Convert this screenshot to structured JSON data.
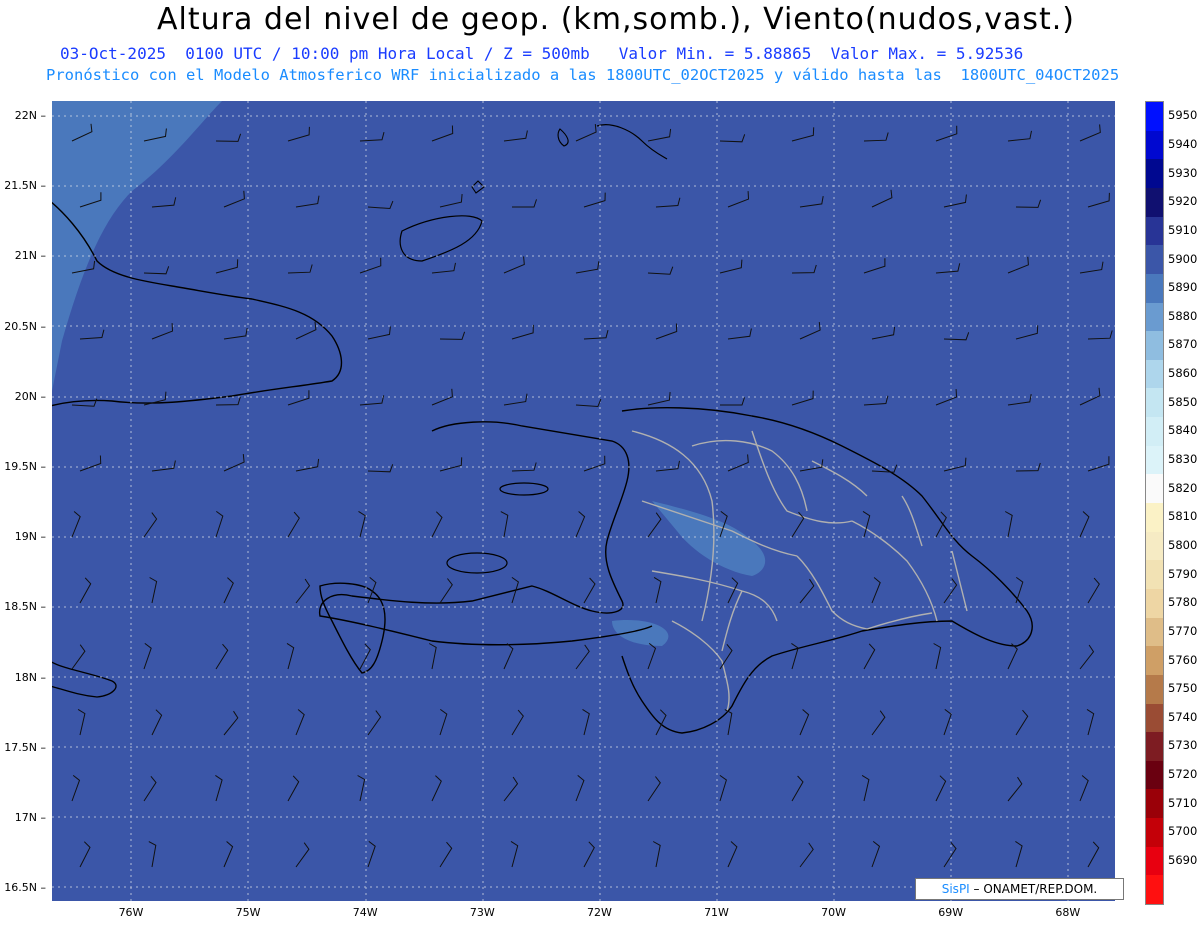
{
  "header": {
    "title": "Altura del nivel de geop. (km,somb.), Viento(nudos,vast.)",
    "line1": "03-Oct-2025  0100 UTC / 10:00 pm Hora Local / Z = 500mb   Valor Min. = 5.88865  Valor Max. = 5.92536",
    "line2": "Pronóstico con el Modelo Atmosferico WRF inicializado a las 1800UTC_02OCT2025 y válido hasta las  1800UTC_04OCT2025"
  },
  "map": {
    "lat_labels": [
      "22N",
      "21.5N",
      "21N",
      "20.5N",
      "20N",
      "19.5N",
      "19N",
      "18.5N",
      "18N",
      "17.5N",
      "17N",
      "16.5N"
    ],
    "lon_labels": [
      "76W",
      "75W",
      "74W",
      "73W",
      "72W",
      "71W",
      "70W",
      "69W",
      "68W"
    ],
    "background_color": "#3b56a8",
    "coastline_color": "#000000",
    "province_border_color": "#b0b0b0",
    "grid": true
  },
  "legend": {
    "levels": [
      {
        "label": "5950",
        "color": "#0010ff"
      },
      {
        "label": "5940",
        "color": "#0008d0"
      },
      {
        "label": "5930",
        "color": "#000890"
      },
      {
        "label": "5920",
        "color": "#101070"
      },
      {
        "label": "5910",
        "color": "#283496"
      },
      {
        "label": "5900",
        "color": "#3b56a8"
      },
      {
        "label": "5890",
        "color": "#4a78bc"
      },
      {
        "label": "5880",
        "color": "#6a9bd0"
      },
      {
        "label": "5870",
        "color": "#8fbde0"
      },
      {
        "label": "5860",
        "color": "#aed6ec"
      },
      {
        "label": "5850",
        "color": "#c4e6f2"
      },
      {
        "label": "5840",
        "color": "#d2eef6"
      },
      {
        "label": "5830",
        "color": "#dcf3f9"
      },
      {
        "label": "5820",
        "color": "#fafafa"
      },
      {
        "label": "5810",
        "color": "#fbf2c6"
      },
      {
        "label": "5800",
        "color": "#f6ebc4"
      },
      {
        "label": "5790",
        "color": "#f2e2b4"
      },
      {
        "label": "5780",
        "color": "#eed6a4"
      },
      {
        "label": "5770",
        "color": "#dfbd88"
      },
      {
        "label": "5760",
        "color": "#cf9f66"
      },
      {
        "label": "5750",
        "color": "#b57a4a"
      },
      {
        "label": "5740",
        "color": "#9a4c34"
      },
      {
        "label": "5730",
        "color": "#7d1c22"
      },
      {
        "label": "5720",
        "color": "#6a0010"
      },
      {
        "label": "5710",
        "color": "#9a0008"
      },
      {
        "label": "5700",
        "color": "#c40008"
      },
      {
        "label": "5690",
        "color": "#e80010"
      },
      {
        "label": "",
        "color": "#ff1010"
      }
    ]
  },
  "credit": {
    "brand": "SisPI",
    "text": " – ONAMET/REP.DOM."
  }
}
